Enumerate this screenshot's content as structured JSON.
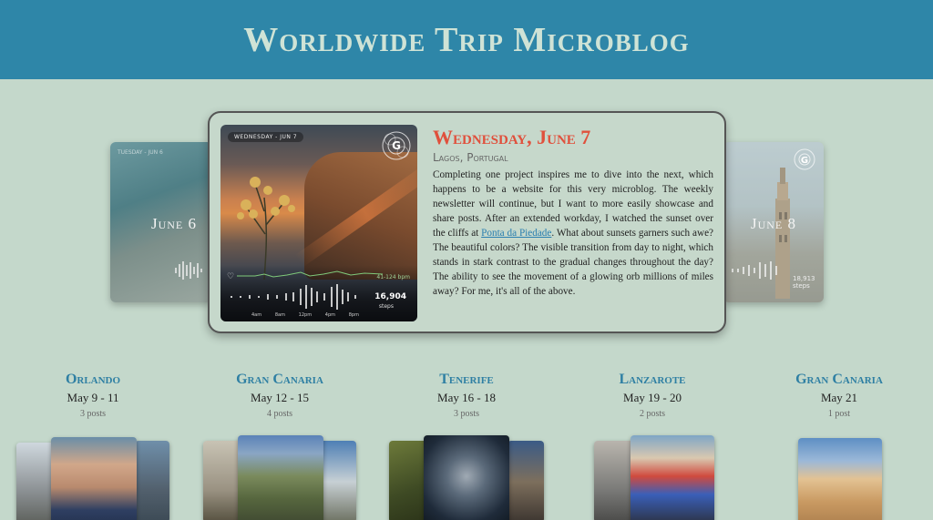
{
  "header": {
    "title": "Worldwide Trip Microblog"
  },
  "carousel": {
    "prev": {
      "label": "June 6",
      "tag": "TUESDAY - JUN 6"
    },
    "next": {
      "label": "June 8",
      "steps": "18,913",
      "steps_unit": "steps"
    },
    "featured": {
      "title": "Wednesday, June 7",
      "location": "Lagos, Portugal",
      "date_tag": "WEDNESDAY - JUN 7",
      "bpm": "41-124 bpm",
      "steps": "16,904",
      "steps_unit": "steps",
      "time_ticks": [
        "4am",
        "8am",
        "12pm",
        "4pm",
        "8pm"
      ],
      "body_before": "Completing one project inspires me to dive into the next, which happens to be a website for this very microblog. The weekly newsletter will continue, but I want to more easily showcase and share posts. After an extended workday, I watched the sunset over the cliffs at ",
      "link_text": "Ponta da Piedade",
      "body_after": ". What about sunsets garners such awe? The beautiful colors? The visible transition from day to night, which stands in stark contrast to the gradual changes throughout the day? The ability to see the movement of a glowing orb millions of miles away? For me, it's all of the above."
    }
  },
  "trips": [
    {
      "name": "Orlando",
      "dates": "May 9 - 11",
      "posts": "3 posts"
    },
    {
      "name": "Gran Canaria",
      "dates": "May 12 - 15",
      "posts": "4 posts"
    },
    {
      "name": "Tenerife",
      "dates": "May 16 - 18",
      "posts": "3 posts"
    },
    {
      "name": "Lanzarote",
      "dates": "May 19 - 20",
      "posts": "2 posts"
    },
    {
      "name": "Gran Canaria",
      "dates": "May 21",
      "posts": "1 post"
    }
  ],
  "colors": {
    "header_bg": "#2e86a8",
    "page_bg": "#c4d8cb",
    "accent_title": "#e0503c",
    "trip_name": "#2e7fa3"
  },
  "icons": [
    "g-logo-icon",
    "heart-icon"
  ]
}
